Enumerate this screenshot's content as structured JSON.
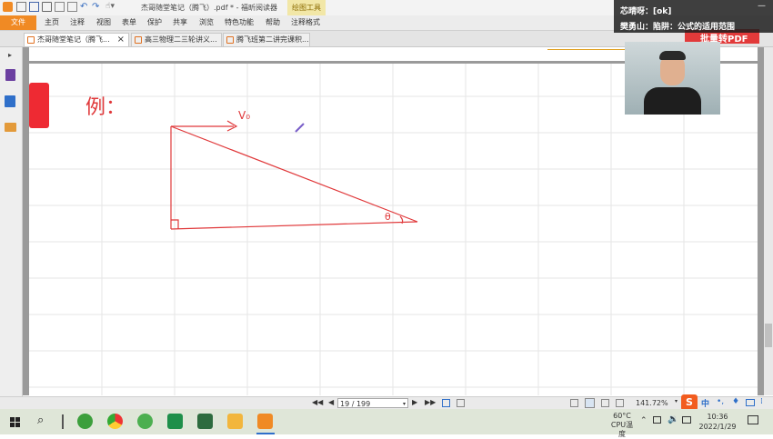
{
  "app": {
    "title": "杰哥随堂笔记（腾飞）.pdf * - 福昕阅读器",
    "contextual_tab": "绘图工具"
  },
  "menu": {
    "file": "文件",
    "items": [
      "主页",
      "注释",
      "视图",
      "表单",
      "保护",
      "共享",
      "浏览",
      "特色功能",
      "帮助",
      "注释格式"
    ]
  },
  "tabs": [
    {
      "label": "杰哥随堂笔记（腾飞...",
      "active": true
    },
    {
      "label": "高三物理二三轮讲义...",
      "active": false
    },
    {
      "label": "腾飞班第二讲完课积...",
      "active": false
    }
  ],
  "document": {
    "example_label": "例：",
    "velocity_label": "V₀",
    "angle_label": "θ"
  },
  "statusbar": {
    "page_display": "19 / 199",
    "zoom": "141.72%"
  },
  "chat": {
    "line1": "芯晴呀：[ok]",
    "line2": "樊勇山：陷阱：公式的适用范围",
    "behind_button": "批量转PDF"
  },
  "taskbar": {
    "cpu_temp": "60°C",
    "cpu_label": "CPU温度",
    "ime": "中",
    "time": "10:36",
    "date": "2022/1/29"
  },
  "colors": {
    "accent": "#f08a24",
    "ink": "#e0383a",
    "bookmark": "#ee2a33"
  }
}
